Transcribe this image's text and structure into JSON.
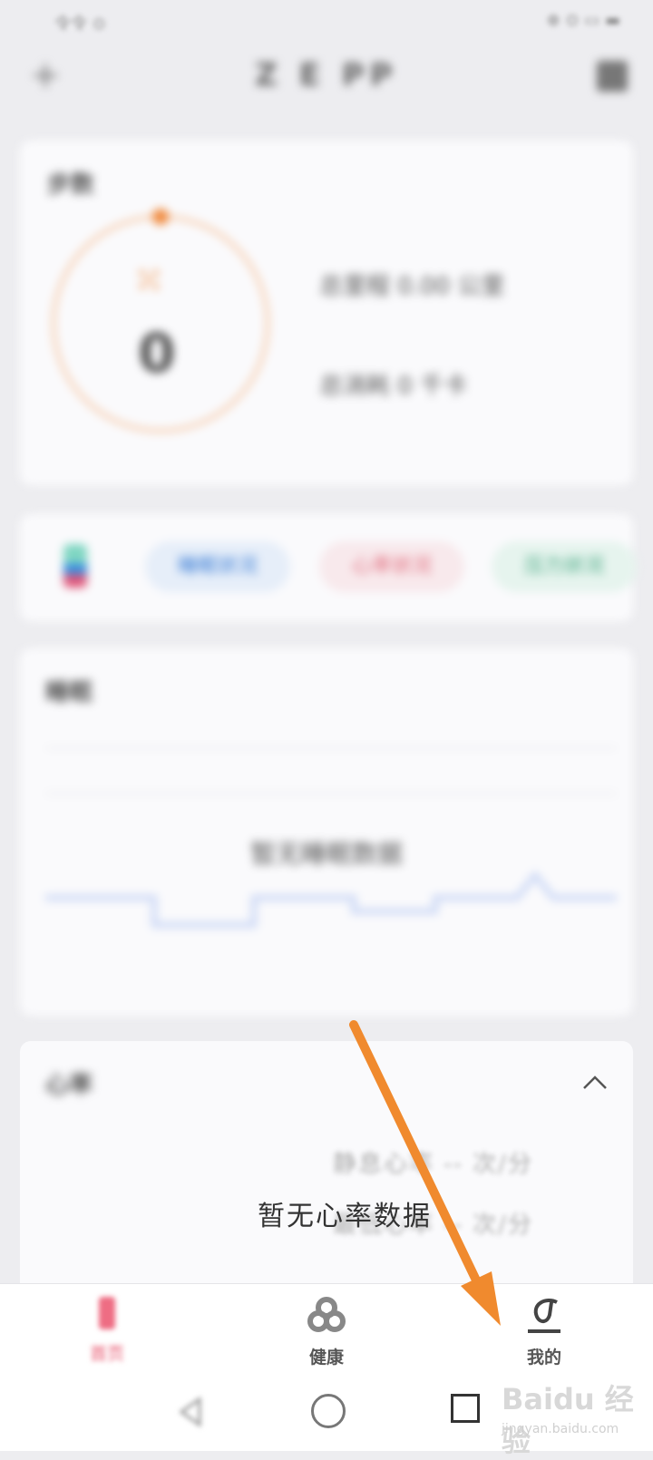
{
  "status_bar": {
    "left": "令令 ⊙",
    "right": "⊕ ⊙ ▭ ▬"
  },
  "header": {
    "title": "Z E PP",
    "add_icon": "plus-icon",
    "menu_icon": "grid-icon"
  },
  "steps_card": {
    "title": "步数",
    "steps_icon": "footsteps-icon",
    "steps_value": "0",
    "distance_line": "总里程 0.00 公里",
    "calorie_line": "总消耗 0 千卡",
    "accent_color": "#f08a3e"
  },
  "chips": [
    "睡眠状况",
    "心率状况",
    "压力状况"
  ],
  "sleep_card": {
    "title": "睡眠",
    "empty_text": "暂无睡眠数据"
  },
  "heart_rate_card": {
    "title": "心率",
    "resting": "静息心率 -- 次/分",
    "minimum": "最低心率 -- 次/分",
    "empty_text": "暂无心率数据",
    "collapse_icon": "chevron-up-icon"
  },
  "bottom_nav": [
    {
      "label": "首页",
      "icon": "home-icon",
      "active": true
    },
    {
      "label": "健康",
      "icon": "health-icon",
      "active": false
    },
    {
      "label": "我的",
      "icon": "profile-icon",
      "active": false
    }
  ],
  "system_nav": {
    "back_icon": "back-triangle-icon",
    "home_icon": "home-circle-icon",
    "recent_icon": "recent-square-icon"
  },
  "watermark": {
    "brand": "Baidu 经验",
    "url": "jingyan.baidu.com"
  },
  "arrow_color": "#f08a2e"
}
